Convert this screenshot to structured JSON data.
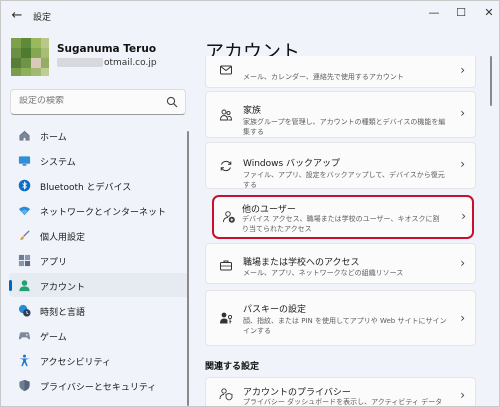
{
  "window": {
    "app_title": "設定",
    "back_icon": "back-arrow-icon",
    "controls": [
      "—",
      "☐",
      "✕"
    ]
  },
  "profile": {
    "name": "Suganuma Teruo",
    "email_visible": "otmail.co.jp"
  },
  "search": {
    "placeholder": "設定の検索"
  },
  "sidebar": {
    "items": [
      {
        "label": "ホーム",
        "icon": "home-icon",
        "active": false
      },
      {
        "label": "システム",
        "icon": "system-icon",
        "active": false
      },
      {
        "label": "Bluetooth とデバイス",
        "icon": "bluetooth-icon",
        "active": false
      },
      {
        "label": "ネットワークとインターネット",
        "icon": "wifi-icon",
        "active": false
      },
      {
        "label": "個人用設定",
        "icon": "brush-icon",
        "active": false
      },
      {
        "label": "アプリ",
        "icon": "apps-icon",
        "active": false
      },
      {
        "label": "アカウント",
        "icon": "account-icon",
        "active": true
      },
      {
        "label": "時刻と言語",
        "icon": "time-language-icon",
        "active": false
      },
      {
        "label": "ゲーム",
        "icon": "game-icon",
        "active": false
      },
      {
        "label": "アクセシビリティ",
        "icon": "accessibility-icon",
        "active": false
      },
      {
        "label": "プライバシーとセキュリティ",
        "icon": "shield-icon",
        "active": false
      }
    ]
  },
  "main": {
    "title": "アカウント",
    "cards": [
      {
        "title": "",
        "desc": "メール、カレンダー、連絡先で使用するアカウント",
        "icon": "mail-icon"
      },
      {
        "title": "家族",
        "desc": "家族グループを管理し、アカウントの種類とデバイスの機能を編集する",
        "icon": "family-icon"
      },
      {
        "title": "Windows バックアップ",
        "desc": "ファイル、アプリ、設定をバックアップして、デバイスから復元する",
        "icon": "backup-icon"
      },
      {
        "title": "他のユーザー",
        "desc": "デバイス アクセス、職場または学校のユーザー、キオスクに割り当てられたアクセス",
        "icon": "add-user-icon"
      },
      {
        "title": "職場または学校へのアクセス",
        "desc": "メール、アプリ、ネットワークなどの組織リソース",
        "icon": "briefcase-icon"
      },
      {
        "title": "パスキーの設定",
        "desc": "顔、指紋、または PIN を使用してアプリや Web サイトにサインインする",
        "icon": "passkey-icon"
      }
    ],
    "related_title": "関連する設定",
    "related": [
      {
        "title": "アカウントのプライバシー",
        "desc": "プライバシー ダッシュボードを表示し、アクティビティ データを管理する",
        "icon": "account-privacy-icon"
      }
    ]
  },
  "colors": {
    "accent": "#0067c0",
    "highlight_border": "#c8102e",
    "background": "#f0f3f9",
    "card": "#fbfbfb"
  }
}
